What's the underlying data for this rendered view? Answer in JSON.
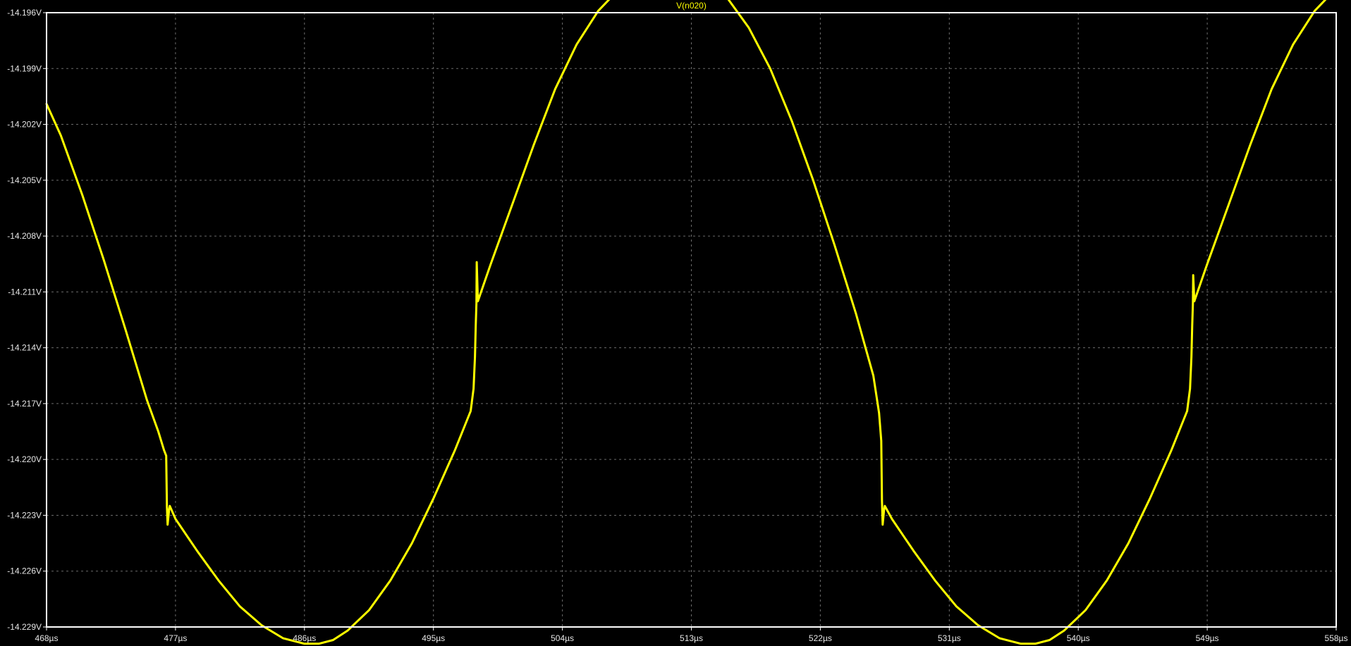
{
  "chart_data": {
    "type": "line",
    "title": "V(n020)",
    "xlabel": "",
    "ylabel": "",
    "xlim": [
      468,
      558
    ],
    "ylim": [
      -14.229,
      -14.196
    ],
    "x_unit": "µs",
    "y_unit": "V",
    "x_ticks": [
      468,
      477,
      486,
      495,
      504,
      513,
      522,
      531,
      540,
      549,
      558
    ],
    "x_tick_labels": [
      "468µs",
      "477µs",
      "486µs",
      "495µs",
      "504µs",
      "513µs",
      "522µs",
      "531µs",
      "540µs",
      "549µs",
      "558µs"
    ],
    "y_ticks": [
      -14.196,
      -14.199,
      -14.202,
      -14.205,
      -14.208,
      -14.211,
      -14.214,
      -14.217,
      -14.22,
      -14.223,
      -14.226,
      -14.229
    ],
    "y_tick_labels": [
      "-14.196V",
      "-14.199V",
      "-14.202V",
      "-14.205V",
      "-14.208V",
      "-14.211V",
      "-14.214V",
      "-14.217V",
      "-14.220V",
      "-14.223V",
      "-14.226V",
      "-14.229V"
    ],
    "grid": true,
    "colors": {
      "background": "#000000",
      "trace": "#ffff00",
      "frame": "#ffffff",
      "grid": "#6b6b6b",
      "tick_text": "#e6e6e6",
      "title": "#ffff00"
    },
    "series": [
      {
        "name": "V(n020)",
        "x": [
          468.0,
          469.0,
          470.5,
          472.0,
          473.5,
          475.0,
          475.8,
          476.2,
          476.35,
          476.4,
          476.45,
          476.55,
          476.6,
          477.0,
          478.5,
          480.0,
          481.5,
          483.0,
          484.5,
          486.0,
          487.0,
          488.0,
          489.0,
          490.5,
          492.0,
          493.5,
          495.0,
          496.5,
          497.6,
          497.8,
          497.9,
          497.95,
          498.0,
          498.02,
          498.1,
          499.0,
          500.5,
          502.0,
          503.5,
          505.0,
          506.5,
          508.0,
          509.5,
          511.0,
          512.0,
          512.8,
          514.0,
          515.5,
          517.0,
          518.5,
          520.0,
          521.5,
          523.0,
          524.5,
          525.7,
          526.1,
          526.25,
          526.3,
          526.35,
          526.45,
          526.5,
          527.0,
          528.5,
          530.0,
          531.5,
          533.0,
          534.5,
          536.0,
          537.0,
          538.0,
          539.0,
          540.5,
          542.0,
          543.5,
          545.0,
          546.5,
          547.6,
          547.8,
          547.9,
          547.95,
          548.0,
          548.02,
          548.1,
          549.0,
          550.5,
          552.0,
          553.5,
          555.0,
          556.5,
          558.0
        ],
        "y": [
          -14.2009,
          -14.2026,
          -14.2058,
          -14.2093,
          -14.213,
          -14.2168,
          -14.2185,
          -14.2195,
          -14.2198,
          -14.2225,
          -14.2235,
          -14.2227,
          -14.2225,
          -14.2232,
          -14.2249,
          -14.2265,
          -14.2279,
          -14.2289,
          -14.2296,
          -14.2299,
          -14.2299,
          -14.2297,
          -14.2292,
          -14.2281,
          -14.2265,
          -14.2245,
          -14.2221,
          -14.2195,
          -14.2174,
          -14.2162,
          -14.2145,
          -14.2128,
          -14.2116,
          -14.2094,
          -14.2115,
          -14.2095,
          -14.2063,
          -14.2031,
          -14.2001,
          -14.1977,
          -14.1959,
          -14.1947,
          -14.194,
          -14.1937,
          -14.1937,
          -14.1938,
          -14.1942,
          -14.1952,
          -14.1968,
          -14.199,
          -14.2018,
          -14.205,
          -14.2085,
          -14.2122,
          -14.2155,
          -14.2175,
          -14.219,
          -14.2222,
          -14.2235,
          -14.2227,
          -14.2225,
          -14.2232,
          -14.2249,
          -14.2265,
          -14.2279,
          -14.2289,
          -14.2296,
          -14.2299,
          -14.2299,
          -14.2297,
          -14.2292,
          -14.2281,
          -14.2265,
          -14.2245,
          -14.2221,
          -14.2195,
          -14.2174,
          -14.2162,
          -14.2145,
          -14.2128,
          -14.2116,
          -14.2101,
          -14.2115,
          -14.2095,
          -14.2063,
          -14.2031,
          -14.2001,
          -14.1977,
          -14.1959,
          -14.1947
        ]
      }
    ]
  }
}
